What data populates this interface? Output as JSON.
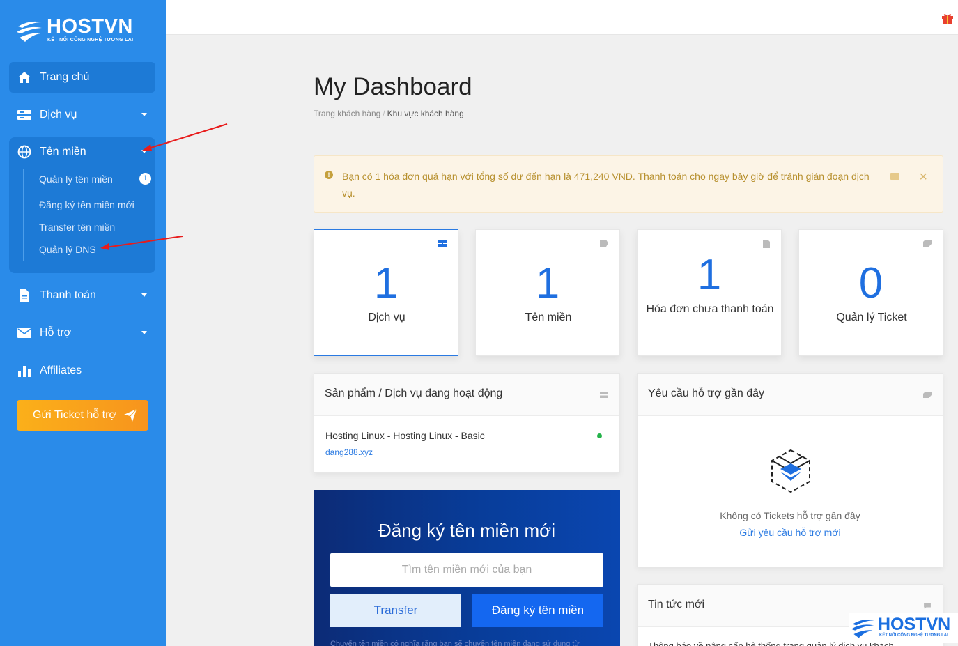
{
  "brand": {
    "name": "HOSTVN",
    "tagline": "KẾT NỐI CÔNG NGHỆ TƯƠNG LAI"
  },
  "sidebar": {
    "items": [
      {
        "label": "Trang chủ",
        "icon": "home-icon"
      },
      {
        "label": "Dịch vụ",
        "icon": "server-icon"
      },
      {
        "label": "Tên miền",
        "icon": "globe-icon"
      },
      {
        "label": "Thanh toán",
        "icon": "document-icon"
      },
      {
        "label": "Hỗ trợ",
        "icon": "envelope-icon"
      },
      {
        "label": "Affiliates",
        "icon": "bar-chart-icon"
      }
    ],
    "domain_sub": [
      {
        "label": "Quản lý tên miền",
        "badge": "1"
      },
      {
        "label": "Đăng ký tên miền mới"
      },
      {
        "label": "Transfer tên miền"
      },
      {
        "label": "Quản lý DNS"
      }
    ],
    "ticket_button": "Gửi Ticket hỗ trợ"
  },
  "page": {
    "title": "My Dashboard",
    "breadcrumb": [
      "Trang khách hàng",
      "Khu vực khách hàng"
    ]
  },
  "alert": {
    "text": "Bạn có 1 hóa đơn quá hạn với tổng số dư đến hạn là 471,240 VND. Thanh toán cho ngay bây giờ để tránh gián đoạn dịch vụ.",
    "color": "#b7902e"
  },
  "stats": [
    {
      "value": "1",
      "label": "Dịch vụ"
    },
    {
      "value": "1",
      "label": "Tên miền"
    },
    {
      "value": "1",
      "label": "Hóa đơn chưa thanh toán"
    },
    {
      "value": "0",
      "label": "Quản lý Ticket"
    }
  ],
  "services_panel": {
    "title": "Sản phẩm / Dịch vụ đang hoạt động",
    "item_name": "Hosting Linux - Hosting Linux - Basic",
    "item_domain": "dang288.xyz",
    "status_color": "#24b34a"
  },
  "register": {
    "title": "Đăng ký tên miền mới",
    "placeholder": "Tìm tên miền mới của bạn",
    "transfer_label": "Transfer",
    "register_label": "Đăng ký tên miền",
    "note": "Chuyển tên miền có nghĩa rằng bạn sẽ chuyển tên miền đang sử dụng từ"
  },
  "support_panel": {
    "title": "Yêu cầu hỗ trợ gần đây",
    "empty_text": "Không có Tickets hỗ trợ gần đây",
    "empty_link": "Gửi yêu cầu hỗ trợ mới"
  },
  "news_panel": {
    "title": "Tin tức mới",
    "first_item": "Thông báo về nâng cấp hệ thống trang quản lý dịch vụ khách"
  },
  "colors": {
    "sidebar": "#2a8be9",
    "accent": "#1f6fe0",
    "ticket": "#f7941d"
  }
}
